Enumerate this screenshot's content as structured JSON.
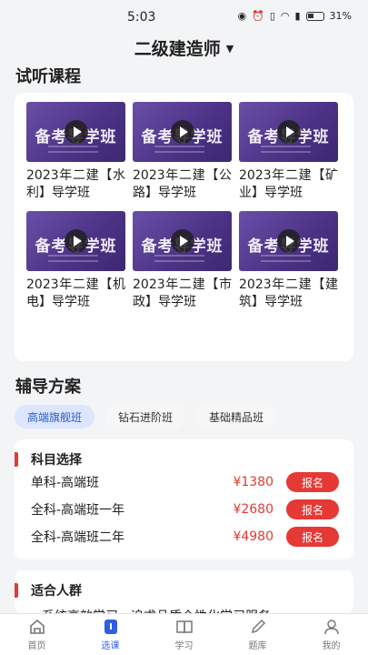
{
  "status": {
    "time": "5:03",
    "battery": "31%"
  },
  "header": {
    "title": "二级建造师"
  },
  "trial": {
    "title": "试听课程",
    "thumb_text": "备考导学班",
    "courses": [
      {
        "label": "2023年二建【水利】导学班"
      },
      {
        "label": "2023年二建【公路】导学班"
      },
      {
        "label": "2023年二建【矿业】导学班"
      },
      {
        "label": "2023年二建【机电】导学班"
      },
      {
        "label": "2023年二建【市政】导学班"
      },
      {
        "label": "2023年二建【建筑】导学班"
      }
    ]
  },
  "plan": {
    "title": "辅导方案",
    "tabs": [
      "高端旗舰班",
      "钻石进阶班",
      "基础精品班"
    ],
    "subjects": {
      "title": "科目选择",
      "items": [
        {
          "name": "单科-高端班",
          "price": "¥1380",
          "button": "报名"
        },
        {
          "name": "全科-高端班一年",
          "price": "¥2680",
          "button": "报名"
        },
        {
          "name": "全科-高端班二年",
          "price": "¥4980",
          "button": "报名"
        }
      ]
    },
    "audience": {
      "title": "适合人群",
      "lines": [
        "系统高效学习，追求品质个性化学习服务"
      ]
    }
  },
  "tabbar": {
    "items": [
      {
        "label": "首页",
        "icon": "home-icon"
      },
      {
        "label": "选课",
        "icon": "course-select-icon"
      },
      {
        "label": "学习",
        "icon": "book-icon"
      },
      {
        "label": "题库",
        "icon": "pen-icon"
      },
      {
        "label": "我的",
        "icon": "user-icon"
      }
    ]
  },
  "colors": {
    "accent": "#e53935",
    "active_tab": "#2f5fe0",
    "chip_active_bg": "#dce6ff"
  }
}
